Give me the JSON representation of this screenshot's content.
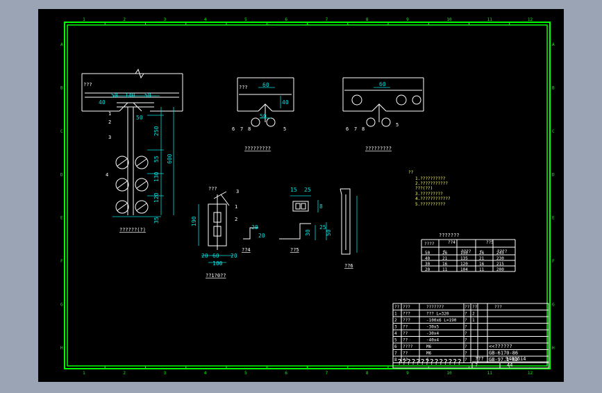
{
  "colors": {
    "background": "#9aa4b4",
    "paper": "#000000",
    "frame": "#00ff00",
    "line": "#ffffff",
    "dim": "#00e0e0",
    "label": "#ffff66",
    "accent": "#ff3030"
  },
  "border": {
    "columns": [
      "1",
      "2",
      "3",
      "4",
      "5",
      "6",
      "7",
      "8",
      "9",
      "10",
      "11",
      "12"
    ],
    "rows": [
      "A",
      "B",
      "C",
      "D",
      "E",
      "F",
      "G",
      "H"
    ]
  },
  "views": {
    "main": {
      "caption": "??????(?)",
      "tag": "???",
      "callouts": [
        "1",
        "2",
        "3",
        "4"
      ],
      "dims_top": [
        "50",
        "140",
        "50"
      ],
      "dims_right": [
        "250",
        "55",
        "130",
        "120",
        "35"
      ],
      "dim_total": "600",
      "dim_small": [
        "40",
        "50"
      ]
    },
    "detail_a": {
      "caption": "?????????",
      "tag": "???",
      "dims": [
        "60",
        "40",
        "50"
      ],
      "callouts": [
        "6",
        "7",
        "8",
        "5"
      ]
    },
    "detail_b": {
      "caption": "?????????",
      "dims": [
        "60"
      ],
      "callouts": [
        "6",
        "7",
        "8",
        "5"
      ]
    },
    "part_1": {
      "caption": "??1?0??",
      "tag": "???",
      "dims_bottom": [
        "20",
        "60",
        "20"
      ],
      "dim_total": "100",
      "dim_side": "190",
      "callouts": [
        "3",
        "1",
        "2"
      ]
    },
    "part_2": {
      "caption": "??4",
      "dims": [
        "20",
        "20"
      ]
    },
    "part_3": {
      "caption": "??5",
      "dims": [
        "15",
        "25",
        "8",
        "30",
        "50",
        "25"
      ]
    },
    "part_4": {
      "caption": "??6"
    }
  },
  "notes": {
    "heading": "??",
    "lines": [
      "1.??????????",
      "2.???????????",
      "  ???(??)",
      "3.?????????",
      "4.????????????",
      "5.??????????"
    ]
  },
  "size_table": {
    "title": "???????",
    "headers": [
      "????",
      "??4",
      "??5"
    ],
    "subheaders": [
      "",
      "r",
      "????",
      "r",
      "????"
    ],
    "rows": [
      [
        "50",
        "26",
        "150",
        "26",
        "245"
      ],
      [
        "40",
        "21",
        "135",
        "21",
        "230"
      ],
      [
        "30",
        "16",
        "120",
        "16",
        "215"
      ],
      [
        "20",
        "11",
        "104",
        "11",
        "200"
      ]
    ]
  },
  "parts_list": {
    "header": [
      "??",
      "???",
      "???????",
      "??",
      "??",
      "???"
    ],
    "rows": [
      [
        "1",
        "???",
        "???  L=320",
        "?",
        "2",
        ""
      ],
      [
        "2",
        "???",
        "-100x6  L=190",
        "?",
        "1",
        ""
      ],
      [
        "3",
        "??",
        "-30x5",
        "?",
        "",
        ""
      ],
      [
        "4",
        "??",
        "-30x4",
        "?",
        "",
        ""
      ],
      [
        "5",
        "??",
        "-40x4",
        "?",
        "",
        ""
      ],
      [
        "6",
        "????",
        "M6",
        "?",
        "",
        "<<??????"
      ],
      [
        "7",
        "??",
        "M6",
        "?",
        "",
        "GB-6170-86"
      ],
      [
        "8",
        "??",
        "6",
        "?",
        "",
        "GB-97.1-85"
      ]
    ],
    "title": "??????????????",
    "drawing_no_label": "???",
    "drawing_no": "94016i4",
    "sheet_label": "?",
    "sheet_value": "44"
  }
}
